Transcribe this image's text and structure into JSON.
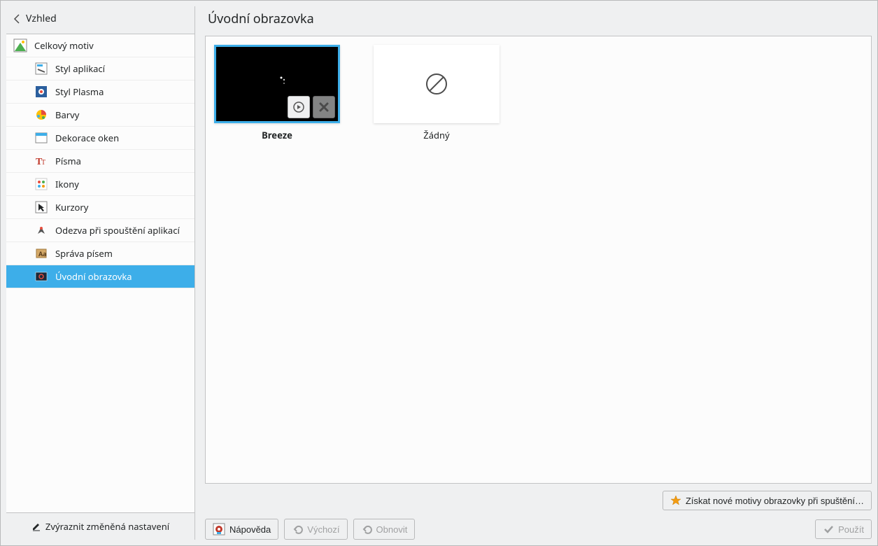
{
  "sidebar": {
    "back_label": "Vzhled",
    "top_item": "Celkový motiv",
    "items": [
      {
        "label": "Styl aplikací"
      },
      {
        "label": "Styl Plasma"
      },
      {
        "label": "Barvy"
      },
      {
        "label": "Dekorace oken"
      },
      {
        "label": "Písma"
      },
      {
        "label": "Ikony"
      },
      {
        "label": "Kurzory"
      },
      {
        "label": "Odezva při spouštění aplikací"
      },
      {
        "label": "Správa písem"
      },
      {
        "label": "Úvodní obrazovka"
      }
    ],
    "footer": "Zvýraznit změněná nastavení"
  },
  "main": {
    "title": "Úvodní obrazovka",
    "themes": [
      {
        "label": "Breeze",
        "selected": true
      },
      {
        "label": "Žádný",
        "selected": false
      }
    ],
    "get_new_label": "Získat nové motivy obrazovky při spuštění…"
  },
  "buttons": {
    "help": "Nápověda",
    "defaults": "Výchozí",
    "reset": "Obnovit",
    "apply": "Použít"
  }
}
